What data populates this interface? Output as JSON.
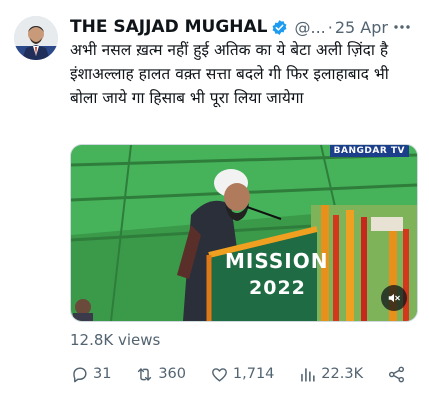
{
  "tweet": {
    "author_name": "THE SAJJAD MUGHAL",
    "handle": "@...",
    "separator": "·",
    "date": "25 Apr",
    "text": "अभी नसल ख़त्म नहीं हुई अतिक का ये बेटा अली ज़िंदा है इंशाअल्लाह हालत वक़्त सत्ता बदले गी फिर इलाहाबाद भी बोला जाये गा हिसाब भी पूरा लिया जायेगा",
    "views": "12.8K views"
  },
  "media": {
    "channel_badge": "BANGDAR TV",
    "banner_line1": "MISSION",
    "banner_line2": "2022"
  },
  "actions": {
    "replies": "31",
    "reposts": "360",
    "likes": "1,714",
    "analytics": "22.3K"
  },
  "icons": {
    "verified": "verified-badge-icon",
    "more": "more-icon",
    "reply": "reply-icon",
    "repost": "repost-icon",
    "like": "heart-icon",
    "analytics": "analytics-icon",
    "share": "share-icon",
    "mute": "speaker-muted-icon"
  },
  "colors": {
    "verified_blue": "#1d9bf0",
    "muted_text": "#536471"
  }
}
